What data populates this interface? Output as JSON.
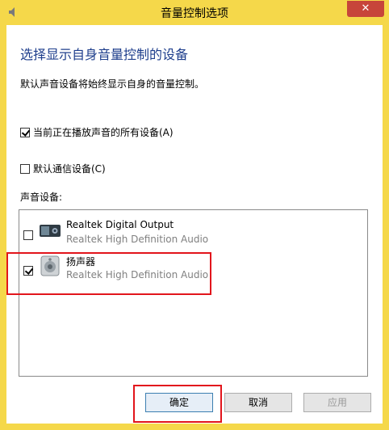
{
  "window": {
    "title": "音量控制选项",
    "close_glyph": "✕"
  },
  "content": {
    "header": "选择显示自身音量控制的设备",
    "description": "默认声音设备将始终显示自身的音量控制。",
    "check_all_playing": "当前正在播放声音的所有设备(A)",
    "check_all_playing_checked": true,
    "check_default_comm": "默认通信设备(C)",
    "check_default_comm_checked": false,
    "group_label": "声音设备:"
  },
  "devices": [
    {
      "name": "Realtek Digital Output",
      "sub": "Realtek High Definition Audio",
      "checked": false,
      "icon": "digital-output-icon"
    },
    {
      "name": "扬声器",
      "sub": "Realtek High Definition Audio",
      "checked": true,
      "icon": "speaker-icon"
    }
  ],
  "buttons": {
    "ok": "确定",
    "cancel": "取消",
    "apply": "应用"
  },
  "colors": {
    "header_blue": "#1e3e8c",
    "highlight_red": "#e2151c",
    "frame_yellow": "#f5d84a"
  }
}
